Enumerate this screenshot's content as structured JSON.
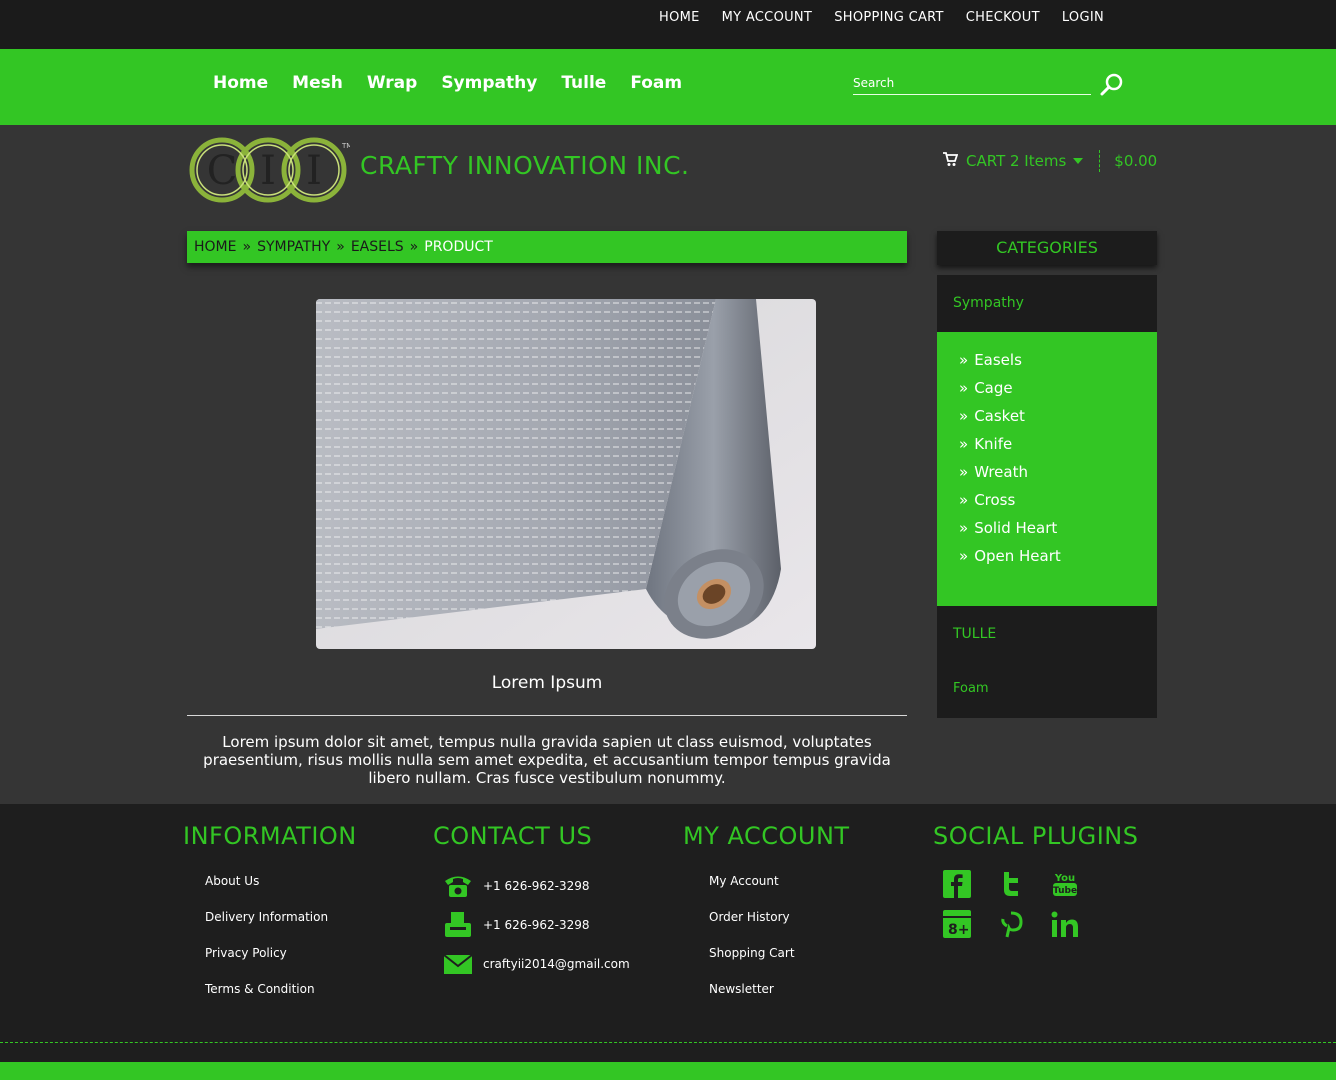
{
  "top_links": [
    "HOME",
    "MY ACCOUNT",
    "SHOPPING CART",
    "CHECKOUT",
    "LOGIN"
  ],
  "main_nav": [
    "Home",
    "Mesh",
    "Wrap",
    "Sympathy",
    "Tulle",
    "Foam"
  ],
  "search": {
    "placeholder": "Search"
  },
  "brand": {
    "logo_text": "CII",
    "name": "CRAFTY INNOVATION INC."
  },
  "cart": {
    "label": "CART 2 Items",
    "total": "$0.00"
  },
  "breadcrumb": {
    "home": "HOME",
    "level1": "SYMPATHY",
    "level2": "EASELS",
    "current": "PRODUCT",
    "separator": "»"
  },
  "product": {
    "title": "Lorem Ipsum",
    "description": "Lorem ipsum dolor sit amet, tempus nulla gravida sapien ut class euismod, voluptates praesentium, risus mollis nulla sem amet expedita, et accusantium tempor tempus gravida libero nullam. Cras fusce vestibulum nonummy."
  },
  "categories": {
    "heading": "CATEGORIES",
    "top": "Sympathy",
    "sub_marker": "»",
    "sub": [
      "Easels",
      "Cage",
      "Casket",
      "Knife",
      "Wreath",
      "Cross",
      "Solid Heart",
      "Open Heart"
    ],
    "after": [
      "TULLE",
      "Foam"
    ]
  },
  "footer": {
    "information": {
      "heading": "INFORMATION",
      "links": [
        "About Us",
        "Delivery Information",
        "Privacy Policy",
        "Terms & Condition"
      ]
    },
    "contact": {
      "heading": "CONTACT US",
      "phone": "+1 626-962-3298",
      "fax": "+1 626-962-3298",
      "email": "craftyii2014@gmail.com"
    },
    "account": {
      "heading": "MY ACCOUNT",
      "links": [
        "My Account",
        "Order History",
        "Shopping Cart",
        "Newsletter"
      ]
    },
    "social": {
      "heading": "SOCIAL PLUGINS",
      "icons": [
        "facebook-icon",
        "twitter-icon",
        "youtube-icon",
        "google-plus-icon",
        "pinterest-icon",
        "linkedin-icon"
      ]
    }
  },
  "colors": {
    "accent": "#33c624",
    "dark": "#1c1c1c",
    "background": "#353535"
  }
}
